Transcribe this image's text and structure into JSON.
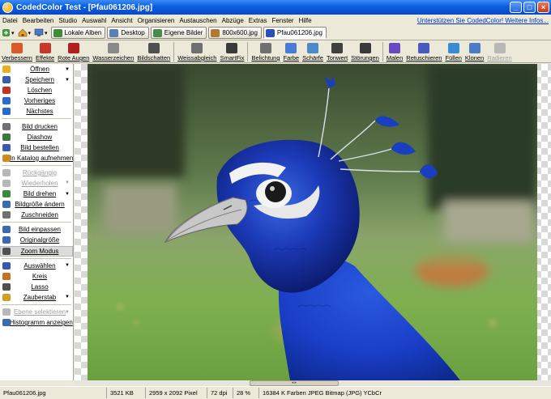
{
  "window": {
    "title": "CodedColor Test - [Pfau061206.jpg]"
  },
  "menu": {
    "items": [
      "Datei",
      "Bearbeiten",
      "Studio",
      "Auswahl",
      "Ansicht",
      "Organisieren",
      "Austauschen",
      "Abzüge",
      "Extras",
      "Fenster",
      "Hilfe"
    ],
    "promo": "Unterstützen Sie CodedColor! Weitere Infos..."
  },
  "tabs": {
    "items": [
      {
        "label": "Lokale Alben",
        "icon": "album-icon",
        "color": "#3c8c3c"
      },
      {
        "label": "Desktop",
        "icon": "desktop-icon",
        "color": "#5a7fb0"
      },
      {
        "label": "Eigene Bilder",
        "icon": "pictures-icon",
        "color": "#4a8a4a"
      },
      {
        "label": "800x600.jpg",
        "icon": "image-icon",
        "color": "#b07a30"
      },
      {
        "label": "Pfau061206.jpg",
        "icon": "image-icon",
        "color": "#2a50b8"
      }
    ]
  },
  "toolbar": {
    "items": [
      {
        "label": "Verbessern",
        "color": "#d85a2a"
      },
      {
        "label": "Effekte",
        "color": "#c8382a"
      },
      {
        "label": "Rote Augen",
        "color": "#b02020"
      },
      {
        "label": "Wasserzeichen",
        "color": "#8a8a8a"
      },
      {
        "label": "Bildschatten",
        "color": "#505050"
      },
      {
        "label": "Weissabgleich",
        "color": "#6f6f6f"
      },
      {
        "label": "SmartFix",
        "color": "#3a3a3a"
      },
      {
        "label": "Belichtung",
        "color": "#707070"
      },
      {
        "label": "Farbe",
        "color": "#4a7ad8"
      },
      {
        "label": "Schärfe",
        "color": "#4a8ac8"
      },
      {
        "label": "Tonwert",
        "color": "#404040"
      },
      {
        "label": "Störungen",
        "color": "#3a3a3a"
      },
      {
        "label": "Malen",
        "color": "#6a4ac0"
      },
      {
        "label": "Retuschieren",
        "color": "#4a5ac0"
      },
      {
        "label": "Füllen",
        "color": "#3a8ad8"
      },
      {
        "label": "Klonen",
        "color": "#4a7ac8"
      },
      {
        "label": "Radieren",
        "color": "#b8b8b8"
      }
    ]
  },
  "sidebar": {
    "groups": [
      [
        {
          "label": "Öffnen",
          "menu": true,
          "color": "#e8b020"
        },
        {
          "label": "Speichern",
          "menu": true,
          "color": "#3a5ab0"
        },
        {
          "label": "Löschen",
          "color": "#c83020"
        },
        {
          "label": "Vorheriges",
          "color": "#2a6ad0"
        },
        {
          "label": "Nächstes",
          "color": "#2a6ad0"
        }
      ],
      [
        {
          "label": "Bild drucken",
          "color": "#707070"
        },
        {
          "label": "Diashow",
          "color": "#3a7a3a"
        },
        {
          "label": "Bild bestellen",
          "color": "#3a5ab0"
        },
        {
          "label": "In Katalog aufnehmen",
          "color": "#d08a20"
        }
      ],
      [
        {
          "label": "Rückgängig",
          "disabled": true,
          "color": "#b8b8b8"
        },
        {
          "label": "Wiederholen",
          "menu": true,
          "disabled": true,
          "color": "#b8b8b8"
        },
        {
          "label": "Bild drehen",
          "menu": true,
          "color": "#3a8a3a"
        },
        {
          "label": "Bildgröße ändern",
          "color": "#3a6ab0"
        },
        {
          "label": "Zuschneiden",
          "color": "#707070"
        }
      ],
      [
        {
          "label": "Bild einpassen",
          "color": "#3a6ab0"
        },
        {
          "label": "Originalgröße",
          "color": "#3a6ab0"
        },
        {
          "label": "Zoom Modus",
          "active": true,
          "color": "#505050"
        }
      ],
      [
        {
          "label": "Auswählen",
          "menu": true,
          "color": "#3a5ab0"
        },
        {
          "label": "Kreis",
          "color": "#c87020"
        },
        {
          "label": "Lasso",
          "color": "#505050"
        },
        {
          "label": "Zauberstab",
          "menu": true,
          "color": "#d0a020"
        }
      ],
      [
        {
          "label": "Ebene selektieren",
          "menu": true,
          "disabled": true,
          "color": "#b8b8b8"
        },
        {
          "label": "Histogramm anzeigen",
          "color": "#3a6ab0"
        }
      ]
    ]
  },
  "status": {
    "filename": "Pfau061206.jpg",
    "filesize": "3521 KB",
    "dimensions": "2959 x 2092 Pixel",
    "dpi": "72 dpi",
    "zoom": "28 %",
    "info": "16384 K Farben JPEG Bitmap (JPG) YCbCr"
  }
}
